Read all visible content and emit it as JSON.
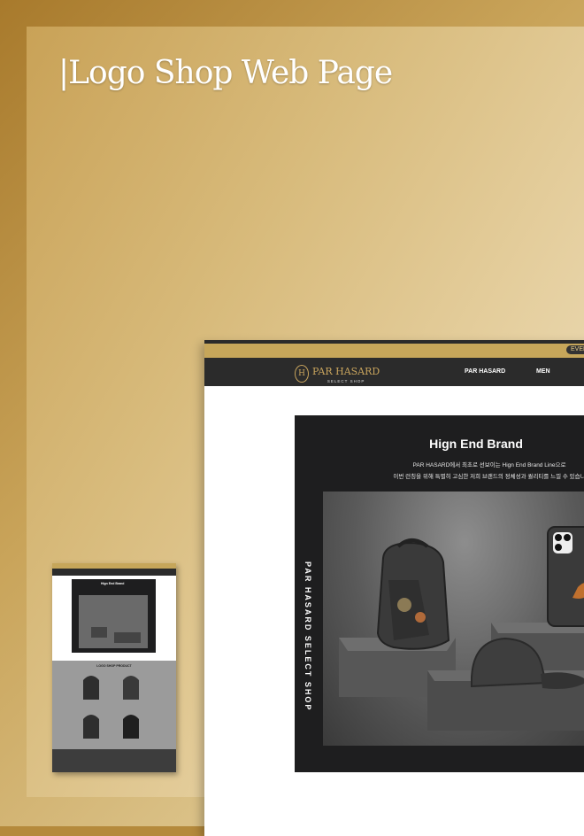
{
  "page": {
    "title": "|Logo Shop Web Page"
  },
  "colors": {
    "gold": "#c6a65a",
    "dark": "#2b2b2b",
    "accent": "#c8a45d"
  },
  "site": {
    "event_badge": "EVEN",
    "logo": {
      "name": "PAR HASARD",
      "sub": "SELECT SHOP",
      "mark": "H"
    },
    "nav": [
      "PAR HASARD",
      "MEN"
    ],
    "hero": {
      "heading": "Hign End Brand",
      "line1": "PAR HASARD에서 최초로 선보이는 Hign End Brand Line으로",
      "line2": "이번 런칭을 위해 특별히 고심한 저희 브랜드의 정체성과 퀄리티를 느낄 수 있습니",
      "vertical": "PAR HASARD SELECT SHOP"
    }
  },
  "small_mock": {
    "hero_heading": "Hign End Brand",
    "vertical": "PAR HASARD SELECT SHOP",
    "products_title": "LOGO SHOP PRODUCT"
  }
}
